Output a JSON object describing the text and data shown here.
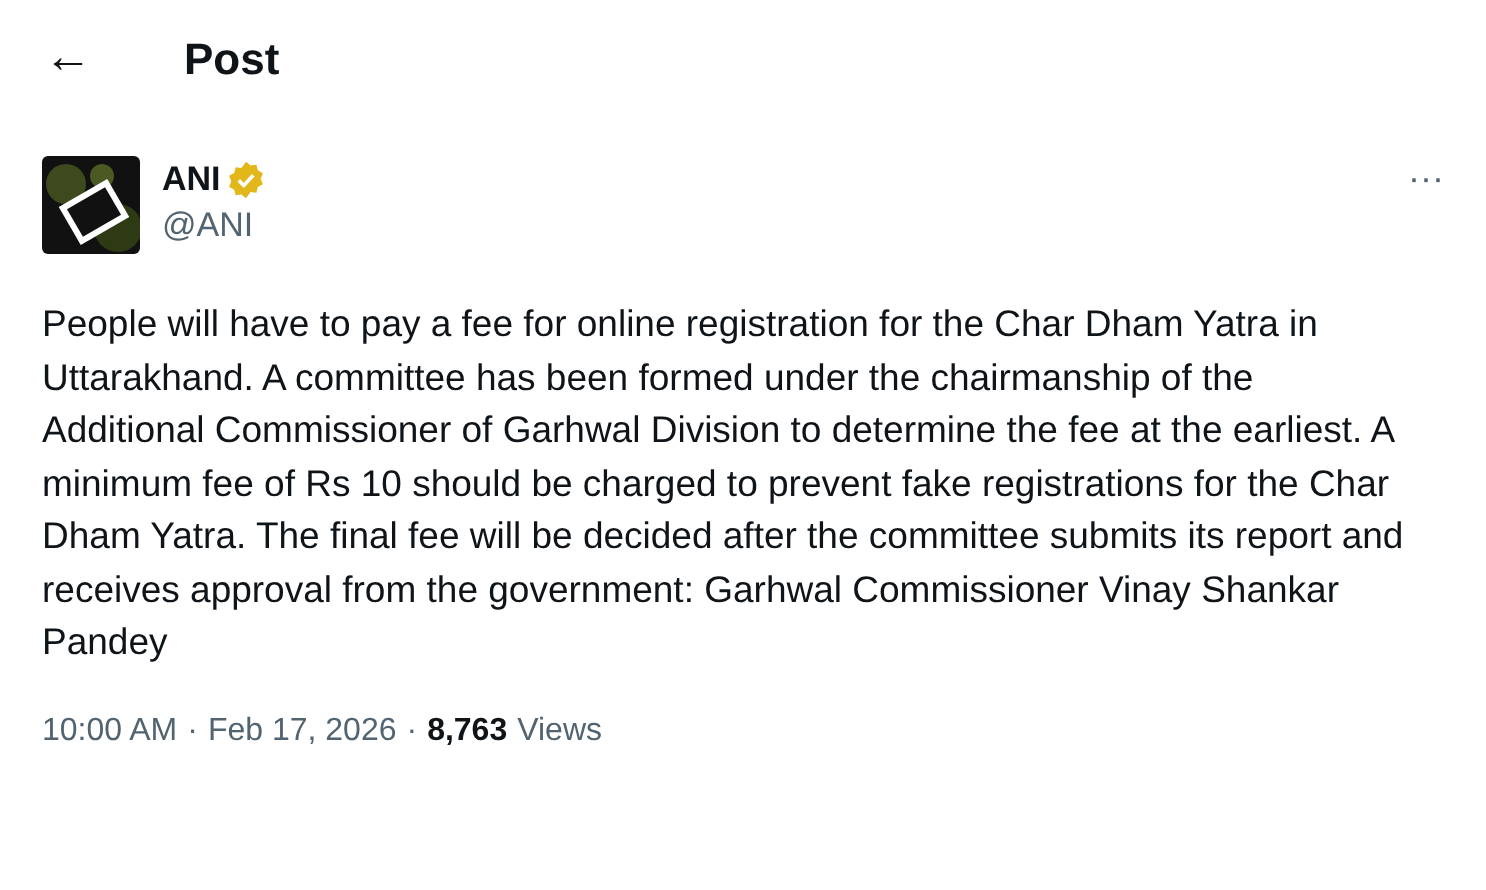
{
  "header": {
    "back": "←",
    "title": "Post"
  },
  "author": {
    "name": "ANI",
    "verified": true,
    "handle": "@ANI"
  },
  "more": "···",
  "text": "People will have to pay a fee for online registration for the Char Dham Yatra in Uttarakhand. A committee has been formed under the chairmanship of the Additional Commissioner of Garhwal Division to determine the fee at the earliest. A minimum fee of Rs 10 should be charged to prevent fake registrations for the Char Dham Yatra. The final fee will be decided after the committee submits its report and receives approval from the government: Garhwal Commissioner Vinay Shankar Pandey",
  "meta": {
    "time": "10:00 AM",
    "separator_1": "·",
    "date": "Feb 17, 2026",
    "separator_2": "·",
    "views_count": "8,763",
    "views_label": "Views"
  }
}
